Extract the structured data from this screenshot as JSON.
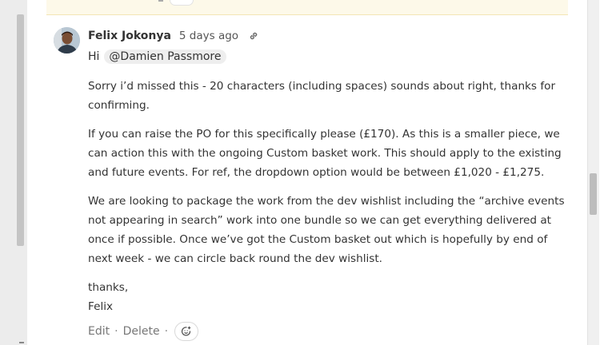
{
  "comment": {
    "author": "Felix Jokonya",
    "timestamp": "5 days ago",
    "greeting": "Hi",
    "mention": "@Damien Passmore",
    "paragraphs": [
      "Sorry i’d missed this - 20 characters (including spaces) sounds about right, thanks for confirming.",
      "If you can raise the PO for this specifically please (£170). As this is a smaller piece, we can action this with the ongoing Custom basket work. This should apply to the existing and future events. For ref, the dropdown option would be between £1,020 - £1,275.",
      "We are looking to package the work from the dev wishlist including the “archive events not appearing in search” work into one bundle so we can get everything delivered at once if possible. Once we’ve got the Custom basket out which is hopefully by end of next week - we can circle back round the dev wishlist."
    ],
    "signoff_1": "thanks,",
    "signoff_2": "Felix"
  },
  "actions": {
    "edit": "Edit",
    "separator": "·",
    "delete": "Delete",
    "react_icon": "add-reaction-icon"
  },
  "icons": {
    "permalink": "link-icon",
    "avatar": "avatar"
  },
  "colors": {
    "highlight_background": "#fdf9e9",
    "mention_background": "#eeeeee"
  }
}
